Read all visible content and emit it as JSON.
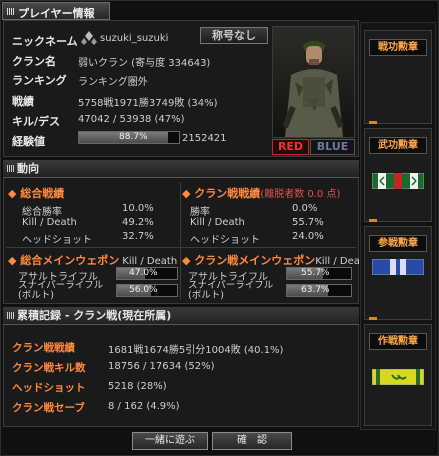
{
  "window_title": "プレイヤー情報",
  "profile": {
    "name_label": "ニックネーム",
    "name_value": "suzuki_suzuki",
    "clan_label": "クラン名",
    "clan_value": "弱いクラン (寄与度 334643)",
    "ranking_label": "ランキング",
    "ranking_value": "ランキング圏外",
    "record_label": "戦績",
    "record_value": "5758戦1971勝3749敗 (34%)",
    "kd_label": "キル/デス",
    "kd_value": "47042 / 53938 (47%)",
    "exp_label": "経験値",
    "exp_percent": "88.7%",
    "exp_fraction": 0.887,
    "exp_value": "2152421",
    "nickname_title_button": "称号なし"
  },
  "team": {
    "red": "RED",
    "blue": "BLUE"
  },
  "trend": {
    "header": "動向",
    "total": {
      "title": "総合戦績",
      "rows": [
        {
          "label": "総合勝率",
          "value": "10.0%"
        },
        {
          "label": "Kill / Death",
          "value": "49.2%"
        },
        {
          "label": "ヘッドショット",
          "value": "32.7%"
        }
      ]
    },
    "clan": {
      "title": "クラン戦戦績",
      "note": "(離脱者数 0.0 点)",
      "rows": [
        {
          "label": "勝率",
          "value": "0.0%"
        },
        {
          "label": "Kill / Death",
          "value": "55.7%"
        },
        {
          "label": "ヘッドショット",
          "value": "24.0%"
        }
      ]
    },
    "main_weapon": {
      "title": "総合メインウェポン",
      "unit": "Kill / Death",
      "rows": [
        {
          "label": "アサルトライフル",
          "value": "47.0%",
          "fraction": 0.47
        },
        {
          "label": "スナイパーライフル\n(ボルト)",
          "value": "56.0%",
          "fraction": 0.56
        }
      ]
    },
    "clan_weapon": {
      "title": "クラン戦メインウェポン",
      "unit": "Kill / Death",
      "rows": [
        {
          "label": "アサルトライフル",
          "value": "55.7%",
          "fraction": 0.557
        },
        {
          "label": "スナイパーライフル\n(ボルト)",
          "value": "63.7%",
          "fraction": 0.637
        }
      ]
    }
  },
  "cumulative": {
    "header": "累積記録 - クラン戦(現在所属)",
    "rows": [
      {
        "label": "クラン戦戦績",
        "value": "1681戦1674勝5引分1004敗 (40.1%)"
      },
      {
        "label": "クラン戦キル数",
        "value": "18756 / 17634 (52%)"
      },
      {
        "label": "ヘッドショット",
        "value": "5218 (28%)"
      },
      {
        "label": "クラン戦セーブ",
        "value": "8 / 162 (4.9%)"
      }
    ]
  },
  "medals": [
    {
      "title": "戦功勲章"
    },
    {
      "title": "武功勲章"
    },
    {
      "title": "参戦勲章"
    },
    {
      "title": "作戦勲章"
    }
  ],
  "buttons": {
    "play_together": "一緒に遊ぶ",
    "confirm": "確　認"
  },
  "colors": {
    "accent": "#ff8a3a",
    "red": "#d82020",
    "blue": "#6a7aa0"
  }
}
